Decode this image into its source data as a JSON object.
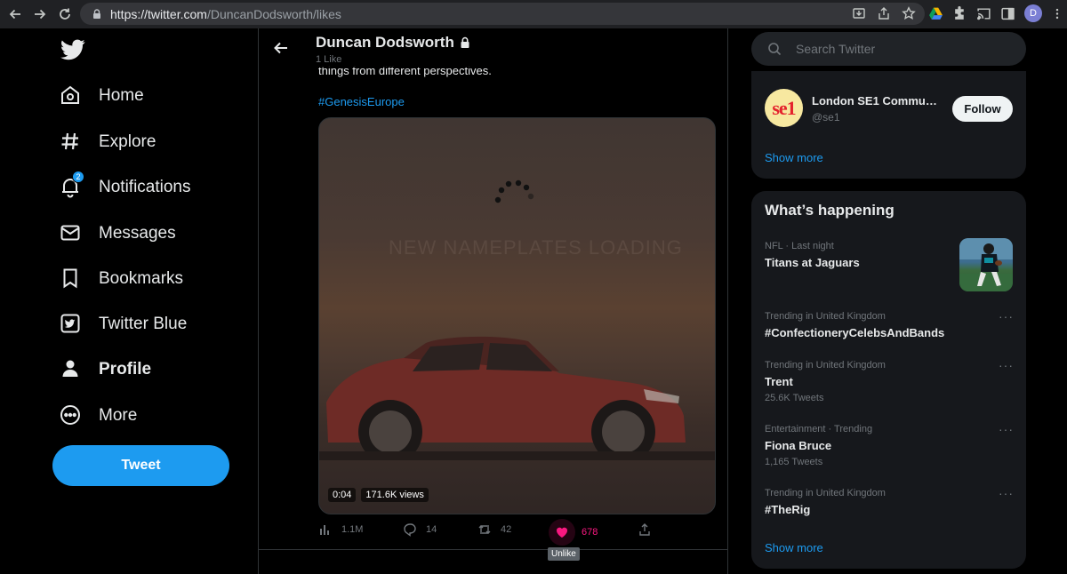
{
  "browser": {
    "url_host": "https://twitter.com",
    "url_path": "/DuncanDodsworth/likes",
    "profile_initial": "D"
  },
  "nav": {
    "items": [
      {
        "label": "Home",
        "icon": "home-icon"
      },
      {
        "label": "Explore",
        "icon": "hashtag-icon"
      },
      {
        "label": "Notifications",
        "icon": "bell-icon",
        "badge": "2"
      },
      {
        "label": "Messages",
        "icon": "envelope-icon"
      },
      {
        "label": "Bookmarks",
        "icon": "bookmark-icon"
      },
      {
        "label": "Twitter Blue",
        "icon": "twitter-blue-icon"
      },
      {
        "label": "Profile",
        "icon": "person-icon"
      },
      {
        "label": "More",
        "icon": "more-circle-icon"
      }
    ],
    "tweet_button": "Tweet"
  },
  "header": {
    "name": "Duncan Dodsworth",
    "sub": "1 Like"
  },
  "tweet": {
    "text": "things from different perspectives.",
    "hashtag": "#GenesisEurope",
    "media_watermark": "NEW NAMEPLATES LOADING",
    "video_time": "0:04",
    "video_views": "171.6K views",
    "views": "1.1M",
    "replies": "14",
    "retweets": "42",
    "likes": "678",
    "tooltip": "Unlike"
  },
  "search": {
    "placeholder": "Search Twitter"
  },
  "who_to_follow": {
    "name": "London SE1 Communi...",
    "handle": "@se1",
    "avatar_text": "se1",
    "follow_label": "Follow",
    "show_more": "Show more"
  },
  "happening": {
    "title": "What’s happening",
    "trends": [
      {
        "meta": "NFL · Last night",
        "title": "Titans at Jaguars",
        "count": ""
      },
      {
        "meta": "Trending in United Kingdom",
        "title": "#ConfectioneryCelebsAndBands",
        "count": ""
      },
      {
        "meta": "Trending in United Kingdom",
        "title": "Trent",
        "count": "25.6K Tweets"
      },
      {
        "meta": "Entertainment · Trending",
        "title": "Fiona Bruce",
        "count": "1,165 Tweets"
      },
      {
        "meta": "Trending in United Kingdom",
        "title": "#TheRig",
        "count": ""
      }
    ],
    "more_menu": "···",
    "show_more": "Show more"
  },
  "colors": {
    "accent": "#1d9bf0",
    "like": "#f91880",
    "background": "#000000",
    "card": "#16181c"
  }
}
